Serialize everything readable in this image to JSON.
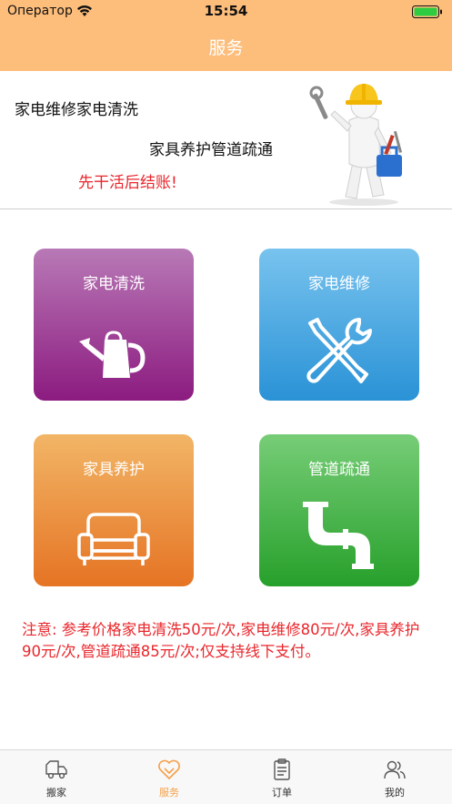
{
  "status_bar": {
    "carrier": "Оператор",
    "time": "15:54"
  },
  "nav": {
    "title": "服务"
  },
  "banner": {
    "line1": "家电维修家电清洗",
    "line2": "家具养护管道疏通",
    "slogan": "先干活后结账!"
  },
  "services": [
    {
      "label": "家电清洗",
      "icon": "watering-can-icon",
      "color_top": "#b879b6",
      "color_bottom": "#8c1b80"
    },
    {
      "label": "家电维修",
      "icon": "wrench-screwdriver-icon",
      "color_top": "#78c3ee",
      "color_bottom": "#2a92d6"
    },
    {
      "label": "家具养护",
      "icon": "sofa-icon",
      "color_top": "#f2b566",
      "color_bottom": "#e57424"
    },
    {
      "label": "管道疏通",
      "icon": "pipe-icon",
      "color_top": "#77cd77",
      "color_bottom": "#27a02b"
    }
  ],
  "notice": "注意:  参考价格家电清洗50元/次,家电维修80元/次,家具养护90元/次,管道疏通85元/次;仅支持线下支付。",
  "tabs": [
    {
      "label": "搬家",
      "icon": "truck-icon",
      "active": false
    },
    {
      "label": "服务",
      "icon": "heart-icon",
      "active": true
    },
    {
      "label": "订单",
      "icon": "clipboard-icon",
      "active": false
    },
    {
      "label": "我的",
      "icon": "users-icon",
      "active": false
    }
  ],
  "colors": {
    "accent": "#fdbd7b",
    "active_tab": "#f5a04a",
    "alert_red": "#e8272c"
  }
}
